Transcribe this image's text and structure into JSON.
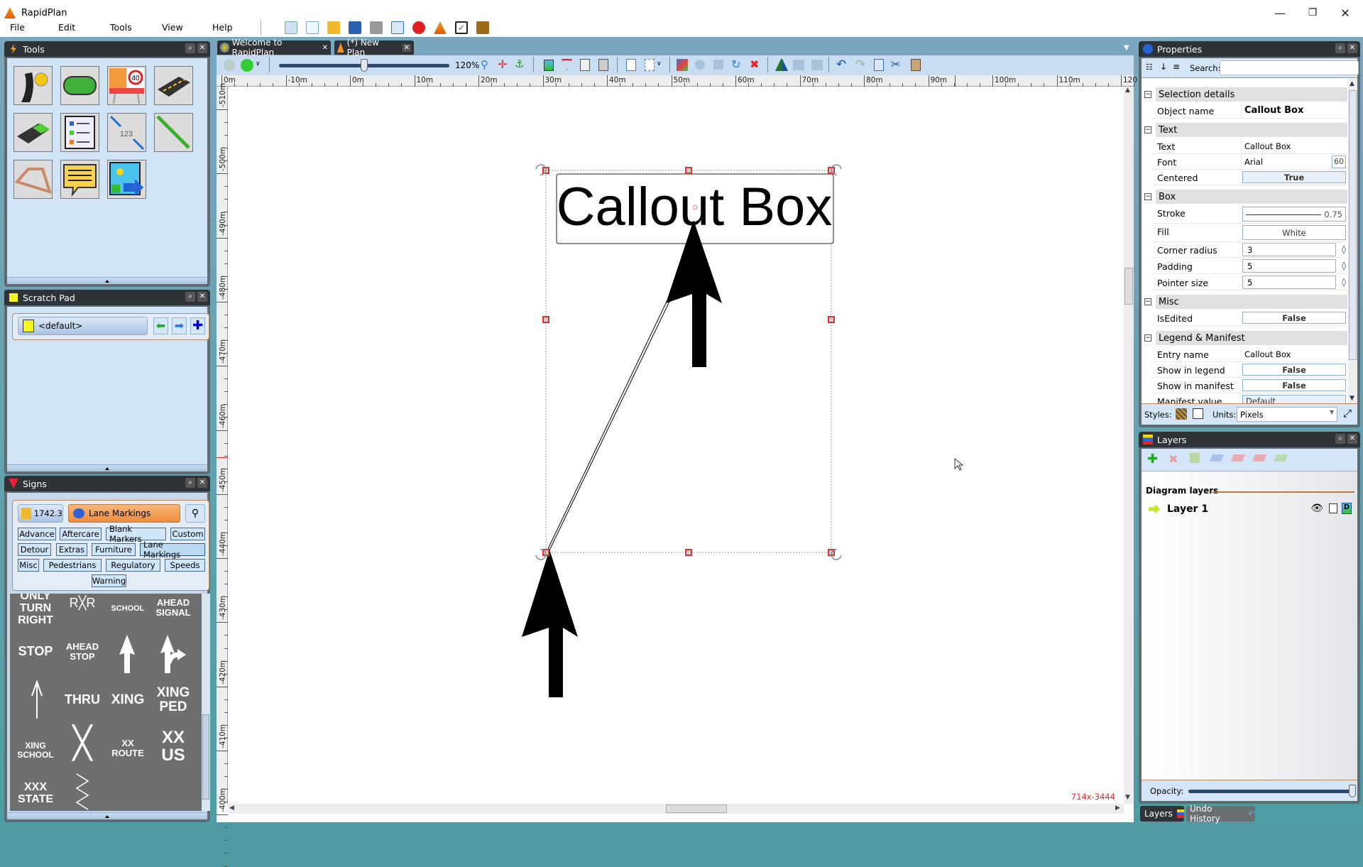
{
  "app": {
    "title": "RapidPlan"
  },
  "window_controls": {
    "minimize": "—",
    "maximize": "❐",
    "close": "✕"
  },
  "menu": [
    "File",
    "Edit",
    "Tools",
    "View",
    "Help"
  ],
  "main_toolbar_icons": [
    "new-wizard-icon",
    "new-document-icon",
    "open-folder-icon",
    "save-icon",
    "print-icon",
    "export-icon",
    "close-red-icon",
    "rapidplan-cone-icon",
    "checklist-icon",
    "exit-door-icon"
  ],
  "panels": {
    "tools": {
      "title": "Tools",
      "items": [
        "road-tool",
        "shape-tool",
        "roadworks-sign-tool",
        "road-segment-tool",
        "lane-area-tool",
        "legend-tool",
        "measure-tool",
        "line-tool",
        "polygon-tool",
        "callout-tool",
        "image-tool"
      ]
    },
    "scratch_pad": {
      "title": "Scratch Pad",
      "selected": "<default>"
    },
    "signs": {
      "title": "Signs",
      "version": "1742.3",
      "current_category": "Lane Markings",
      "categories": [
        "Advance",
        "Aftercare",
        "Blank Markers",
        "Custom",
        "Detour",
        "Extras",
        "Furniture",
        "Lane Markings",
        "Misc",
        "Pedestrians",
        "Regulatory",
        "Speeds",
        "Warning"
      ],
      "markings": [
        {
          "label": "ONLY\nTURN\nRIGHT"
        },
        {
          "label": "RXR"
        },
        {
          "label": "SCHOOL"
        },
        {
          "label": "AHEAD\nSIGNAL"
        },
        {
          "label": "STOP"
        },
        {
          "label": "AHEAD\nSTOP"
        },
        {
          "label": "straight-arrow"
        },
        {
          "label": "straight-right-arrow"
        },
        {
          "label": "thin-arrow"
        },
        {
          "label": "THRU"
        },
        {
          "label": "XING"
        },
        {
          "label": "XING\nPED"
        },
        {
          "label": "XING\nSCHOOL"
        },
        {
          "label": "X RR"
        },
        {
          "label": "XX\nROUTE"
        },
        {
          "label": "XX\nUS"
        },
        {
          "label": "XXX\nSTATE"
        },
        {
          "label": "zigzag"
        }
      ]
    }
  },
  "document_tabs": [
    {
      "label": "Welcome to RapidPlan",
      "active": false
    },
    {
      "label": "(*) New Plan",
      "active": true
    }
  ],
  "canvas_toolbar": {
    "zoom": "120%",
    "zoom_slider_fraction": 0.5
  },
  "ruler": {
    "horizontal": [
      "0m",
      "-10m",
      "0m",
      "10m",
      "20m",
      "30m",
      "40m",
      "50m",
      "60m",
      "70m",
      "80m",
      "90m",
      "100m",
      "110m",
      "120"
    ],
    "vertical": [
      "-510m",
      "-500m",
      "-490m",
      "-480m",
      "-470m",
      "-460m",
      "-450m",
      "-440m",
      "-430m",
      "-420m",
      "-410m",
      "-400m"
    ]
  },
  "canvas": {
    "callout_text": "Callout Box",
    "coords": "714x-3444"
  },
  "properties": {
    "title": "Properties",
    "search_label": "Search:",
    "search_value": "",
    "sections": {
      "selection": {
        "label": "Selection details",
        "object_name_label": "Object name",
        "object_name": "Callout Box"
      },
      "text": {
        "label": "Text",
        "text_label": "Text",
        "text": "Callout Box",
        "font_label": "Font",
        "font": "Arial",
        "font_size": "60",
        "centered_label": "Centered",
        "centered": "True"
      },
      "box": {
        "label": "Box",
        "stroke_label": "Stroke",
        "stroke": "0.75",
        "fill_label": "Fill",
        "fill": "White",
        "corner_label": "Corner radius",
        "corner": "3",
        "padding_label": "Padding",
        "padding": "5",
        "pointer_label": "Pointer size",
        "pointer": "5"
      },
      "misc": {
        "label": "Misc",
        "isedited_label": "IsEdited",
        "isedited": "False"
      },
      "legend": {
        "label": "Legend & Manifest",
        "entry_label": "Entry name",
        "entry": "Callout Box",
        "show_legend_label": "Show in legend",
        "show_legend": "False",
        "show_manifest_label": "Show in manifest",
        "show_manifest": "False",
        "manifest_value_label": "Manifest value",
        "manifest_value": "Default"
      }
    },
    "styles_label": "Styles:",
    "units_label": "Units:",
    "units": "Pixels"
  },
  "layers": {
    "title": "Layers",
    "section_label": "Diagram layers",
    "items": [
      {
        "name": "Layer 1"
      }
    ],
    "opacity_label": "Opacity:",
    "opacity": 1.0
  },
  "bottom_tabs": [
    {
      "label": "Layers",
      "active": true
    },
    {
      "label": "Undo History",
      "active": false
    }
  ]
}
